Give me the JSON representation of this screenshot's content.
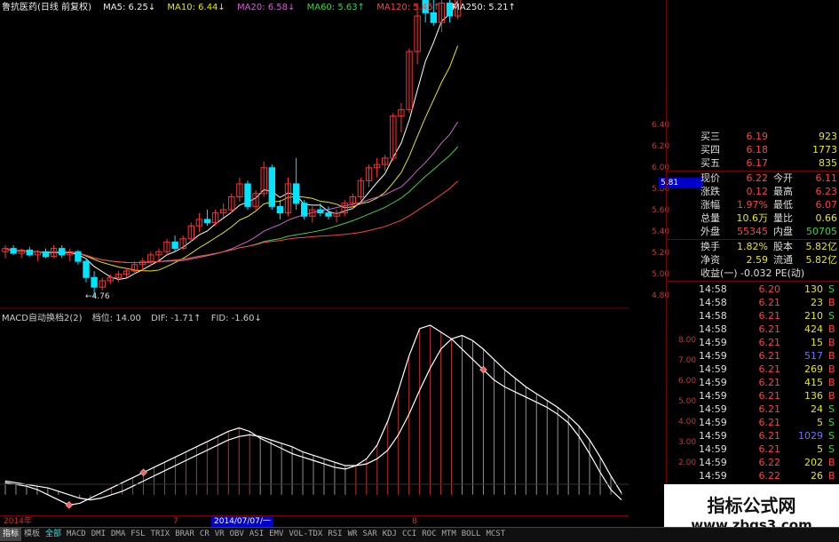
{
  "header": {
    "title": "鲁抗医药(日线 前复权)",
    "ma5": "MA5: 6.25",
    "ma10": "MA10: 6.44",
    "ma20": "MA20: 6.58",
    "ma60": "MA60: 5.63",
    "ma120": "MA120: 5.45",
    "ma250": "MA250: 5.21",
    "ma5_arrow": "↓",
    "ma10_arrow": "↓",
    "ma20_arrow": "↓",
    "ma60_arrow": "↑",
    "ma120_arrow": "↑",
    "ma250_arrow": "↑"
  },
  "low_label": "←4.76",
  "macd_header": {
    "name": "MACD自动换档2(2)",
    "gear": "档位: 14.00",
    "dif": "DIF: -1.71↑",
    "fid": "FID: -1.60↓"
  },
  "price_axis": [
    "6.40",
    "6.20",
    "6.00",
    "5.80",
    "5.60",
    "5.40",
    "5.20",
    "5.00",
    "4.80"
  ],
  "price_cursor": "5.81",
  "macd_axis": [
    "8.00",
    "7.00",
    "6.00",
    "5.00",
    "4.00",
    "3.00",
    "2.00"
  ],
  "date_axis": {
    "start": "2014年",
    "m7": "7",
    "cursor_date": "2014/07/07/一",
    "m8": "8"
  },
  "quote": {
    "bids": [
      {
        "label": "买三",
        "price": "6.19",
        "vol": "923"
      },
      {
        "label": "买四",
        "price": "6.18",
        "vol": "1773"
      },
      {
        "label": "买五",
        "price": "6.17",
        "vol": "835"
      }
    ],
    "stats": [
      {
        "l1": "现价",
        "v1": "6.22",
        "l2": "今开",
        "v2": "6.11"
      },
      {
        "l1": "涨跌",
        "v1": "0.12",
        "l2": "最高",
        "v2": "6.23"
      },
      {
        "l1": "涨幅",
        "v1": "1.97%",
        "l2": "最低",
        "v2": "6.07"
      },
      {
        "l1": "总量",
        "v1": "10.6万",
        "l2": "量比",
        "v2": "0.66"
      },
      {
        "l1": "外盘",
        "v1": "55345",
        "l2": "内盘",
        "v2": "50705"
      }
    ],
    "stats2": [
      {
        "l1": "换手",
        "v1": "1.82%",
        "l2": "股本",
        "v2": "5.82亿"
      },
      {
        "l1": "净资",
        "v1": "2.59",
        "l2": "流通",
        "v2": "5.82亿"
      }
    ],
    "earnings": "收益(一) -0.032 PE(动)"
  },
  "ticks": [
    {
      "t": "14:58",
      "p": "6.20",
      "v": "130",
      "d": "S"
    },
    {
      "t": "14:58",
      "p": "6.21",
      "v": "23",
      "d": "B"
    },
    {
      "t": "14:58",
      "p": "6.21",
      "v": "210",
      "d": "S"
    },
    {
      "t": "14:58",
      "p": "6.21",
      "v": "424",
      "d": "B"
    },
    {
      "t": "14:59",
      "p": "6.21",
      "v": "15",
      "d": "B"
    },
    {
      "t": "14:59",
      "p": "6.21",
      "v": "517",
      "d": "B"
    },
    {
      "t": "14:59",
      "p": "6.21",
      "v": "269",
      "d": "B"
    },
    {
      "t": "14:59",
      "p": "6.21",
      "v": "415",
      "d": "B"
    },
    {
      "t": "14:59",
      "p": "6.21",
      "v": "136",
      "d": "B"
    },
    {
      "t": "14:59",
      "p": "6.21",
      "v": "24",
      "d": "S"
    },
    {
      "t": "14:59",
      "p": "6.21",
      "v": "5",
      "d": "S"
    },
    {
      "t": "14:59",
      "p": "6.21",
      "v": "1029",
      "d": "S"
    },
    {
      "t": "14:59",
      "p": "6.21",
      "v": "5",
      "d": "S"
    },
    {
      "t": "14:59",
      "p": "6.22",
      "v": "202",
      "d": "B"
    },
    {
      "t": "14:59",
      "p": "6.22",
      "v": "26",
      "d": "B"
    }
  ],
  "watermark": {
    "title": "指标公式网",
    "url": "www.zbgs3.com"
  },
  "tabs": [
    "指标",
    "模板",
    "全部",
    "MACD",
    "DMI",
    "DMA",
    "FSL",
    "TRIX",
    "BRAR",
    "CR",
    "VR",
    "OBV",
    "ASI",
    "EMV",
    "VOL-TDX",
    "RSI",
    "WR",
    "SAR",
    "KDJ",
    "CCI",
    "ROC",
    "MTM",
    "BOLL",
    "MCST"
  ],
  "colors": {
    "up": "#ff3030",
    "down": "#00e5ff",
    "ma5": "#ffffff",
    "ma10": "#e8e800",
    "ma20": "#d060d0",
    "ma60": "#40d040",
    "ma120": "#ff4040",
    "ma250": "#ffffff"
  },
  "chart_data": {
    "type": "candlestick",
    "price_ylim": [
      4.7,
      6.5
    ],
    "candles": [
      [
        5.04,
        5.08,
        5.0,
        5.06
      ],
      [
        5.06,
        5.08,
        5.02,
        5.03
      ],
      [
        5.03,
        5.06,
        5.0,
        5.05
      ],
      [
        5.05,
        5.07,
        5.01,
        5.02
      ],
      [
        5.02,
        5.05,
        4.98,
        5.04
      ],
      [
        5.04,
        5.06,
        5.0,
        5.01
      ],
      [
        5.01,
        5.08,
        5.0,
        5.06
      ],
      [
        5.06,
        5.08,
        5.0,
        5.02
      ],
      [
        5.02,
        5.06,
        4.98,
        5.04
      ],
      [
        5.04,
        5.05,
        4.96,
        4.98
      ],
      [
        4.98,
        5.0,
        4.85,
        4.88
      ],
      [
        4.88,
        4.92,
        4.76,
        4.82
      ],
      [
        4.82,
        4.88,
        4.8,
        4.86
      ],
      [
        4.86,
        4.9,
        4.84,
        4.88
      ],
      [
        4.88,
        4.92,
        4.85,
        4.9
      ],
      [
        4.9,
        4.94,
        4.88,
        4.92
      ],
      [
        4.92,
        4.98,
        4.9,
        4.96
      ],
      [
        4.96,
        5.0,
        4.92,
        4.98
      ],
      [
        4.98,
        5.04,
        4.95,
        5.02
      ],
      [
        5.02,
        5.06,
        4.98,
        5.04
      ],
      [
        5.04,
        5.12,
        5.02,
        5.1
      ],
      [
        5.1,
        5.14,
        5.04,
        5.06
      ],
      [
        5.06,
        5.14,
        5.05,
        5.12
      ],
      [
        5.12,
        5.22,
        5.1,
        5.2
      ],
      [
        5.2,
        5.28,
        5.16,
        5.24
      ],
      [
        5.24,
        5.3,
        5.2,
        5.22
      ],
      [
        5.22,
        5.3,
        5.2,
        5.28
      ],
      [
        5.28,
        5.34,
        5.25,
        5.3
      ],
      [
        5.3,
        5.4,
        5.28,
        5.38
      ],
      [
        5.38,
        5.5,
        5.35,
        5.46
      ],
      [
        5.46,
        5.48,
        5.3,
        5.32
      ],
      [
        5.32,
        5.42,
        5.3,
        5.4
      ],
      [
        5.4,
        5.6,
        5.38,
        5.56
      ],
      [
        5.56,
        5.58,
        5.3,
        5.32
      ],
      [
        5.32,
        5.36,
        5.24,
        5.28
      ],
      [
        5.28,
        5.5,
        5.26,
        5.46
      ],
      [
        5.46,
        5.62,
        5.3,
        5.34
      ],
      [
        5.34,
        5.36,
        5.24,
        5.26
      ],
      [
        5.26,
        5.32,
        5.22,
        5.3
      ],
      [
        5.3,
        5.34,
        5.26,
        5.28
      ],
      [
        5.28,
        5.32,
        5.24,
        5.26
      ],
      [
        5.26,
        5.3,
        5.22,
        5.28
      ],
      [
        5.28,
        5.36,
        5.26,
        5.34
      ],
      [
        5.34,
        5.4,
        5.3,
        5.38
      ],
      [
        5.38,
        5.5,
        5.36,
        5.48
      ],
      [
        5.48,
        5.58,
        5.44,
        5.56
      ],
      [
        5.56,
        5.62,
        5.5,
        5.58
      ],
      [
        5.58,
        5.64,
        5.54,
        5.62
      ],
      [
        5.62,
        5.9,
        5.6,
        5.88
      ],
      [
        5.88,
        5.96,
        5.78,
        5.92
      ],
      [
        5.92,
        6.3,
        5.9,
        6.28
      ],
      [
        6.28,
        6.58,
        6.2,
        6.5
      ],
      [
        6.6,
        6.72,
        6.46,
        6.52
      ],
      [
        6.52,
        6.66,
        6.44,
        6.46
      ],
      [
        6.46,
        6.6,
        6.4,
        6.58
      ],
      [
        6.58,
        6.64,
        6.46,
        6.5
      ],
      [
        6.5,
        7.3,
        6.48,
        6.9
      ]
    ],
    "macd_ylim": [
      -2.0,
      9.0
    ],
    "dif": [
      -0.2,
      -0.3,
      -0.4,
      -0.6,
      -0.9,
      -1.2,
      -1.5,
      -1.4,
      -1.1,
      -0.8,
      -0.5,
      -0.2,
      0.1,
      0.4,
      0.7,
      1.0,
      1.3,
      1.6,
      1.9,
      2.2,
      2.5,
      2.8,
      3.0,
      2.8,
      2.4,
      2.1,
      1.8,
      1.5,
      1.3,
      1.1,
      0.9,
      0.7,
      0.6,
      0.8,
      1.2,
      2.0,
      3.4,
      5.2,
      7.2,
      8.8,
      9.0,
      8.6,
      8.2,
      7.6,
      7.0,
      6.4,
      5.8,
      5.4,
      5.1,
      4.8,
      4.5,
      4.2,
      3.8,
      3.3,
      2.5,
      1.5,
      0.4,
      -0.6,
      -1.2
    ],
    "dea": [
      -0.1,
      -0.2,
      -0.3,
      -0.4,
      -0.5,
      -0.7,
      -0.9,
      -1.1,
      -1.2,
      -1.1,
      -0.9,
      -0.7,
      -0.4,
      -0.1,
      0.2,
      0.5,
      0.8,
      1.1,
      1.4,
      1.7,
      2.0,
      2.3,
      2.5,
      2.6,
      2.5,
      2.3,
      2.1,
      1.9,
      1.6,
      1.4,
      1.2,
      1.0,
      0.8,
      0.8,
      0.9,
      1.2,
      1.7,
      2.6,
      3.8,
      5.2,
      6.5,
      7.6,
      8.2,
      8.4,
      8.1,
      7.6,
      7.0,
      6.4,
      5.9,
      5.4,
      5.0,
      4.6,
      4.2,
      3.7,
      3.1,
      2.3,
      1.3,
      0.2,
      -0.8
    ]
  }
}
